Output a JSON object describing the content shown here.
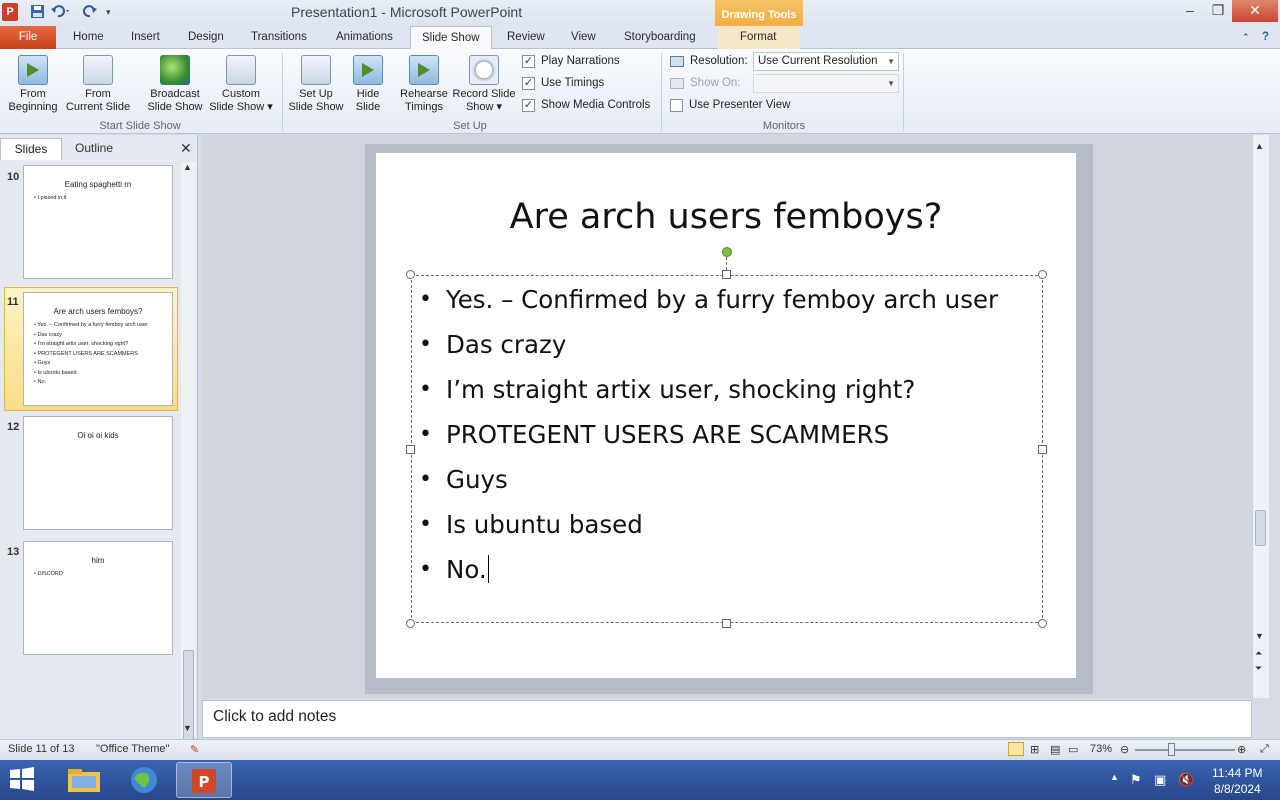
{
  "window": {
    "title": "Presentation1 - Microsoft PowerPoint",
    "contextual_tab_group": "Drawing Tools",
    "app_icon_letter": "P"
  },
  "tabs": [
    "File",
    "Home",
    "Insert",
    "Design",
    "Transitions",
    "Animations",
    "Slide Show",
    "Review",
    "View",
    "Storyboarding",
    "Format"
  ],
  "ribbon": {
    "start_group": {
      "label": "Start Slide Show",
      "from_beginning": [
        "From",
        "Beginning"
      ],
      "from_current": [
        "From",
        "Current Slide"
      ],
      "broadcast": [
        "Broadcast",
        "Slide Show"
      ],
      "custom": [
        "Custom",
        "Slide Show ▾"
      ]
    },
    "setup_group": {
      "label": "Set Up",
      "setup_show": [
        "Set Up",
        "Slide Show"
      ],
      "hide_slide": [
        "Hide",
        "Slide"
      ],
      "rehearse": [
        "Rehearse",
        "Timings"
      ],
      "record": [
        "Record Slide",
        "Show ▾"
      ],
      "play_narrations": "Play Narrations",
      "use_timings": "Use Timings",
      "show_media_controls": "Show Media Controls"
    },
    "monitors_group": {
      "label": "Monitors",
      "resolution_label": "Resolution:",
      "resolution_value": "Use Current Resolution",
      "show_on_label": "Show On:",
      "presenter_view": "Use Presenter View"
    }
  },
  "panel": {
    "tab_slides": "Slides",
    "tab_outline": "Outline",
    "thumbnails": [
      {
        "num": "10",
        "title": "Eating spaghetti rn",
        "bullets": [
          "I pissed in it"
        ]
      },
      {
        "num": "11",
        "title": "Are arch users femboys?",
        "bullets": [
          "Yes. – Confirmed by a furry femboy arch user",
          "Das crazy",
          "I’m straight artix user, shocking right?",
          "PROTEGENT USERS ARE SCAMMERS",
          "Guys",
          "Is ubuntu based",
          "No."
        ]
      },
      {
        "num": "12",
        "title": "Oi oi oi kids",
        "bullets": []
      },
      {
        "num": "13",
        "title": "him",
        "bullets": [
          "DISCORD"
        ]
      }
    ]
  },
  "slide": {
    "title": "Are arch users femboys?",
    "bullets": [
      "Yes. – Confirmed by a furry femboy arch user",
      "Das crazy",
      "I’m straight artix user, shocking right?",
      "PROTEGENT USERS ARE SCAMMERS",
      "Guys",
      "Is ubuntu based",
      "No."
    ]
  },
  "notes": {
    "placeholder": "Click to add notes"
  },
  "status": {
    "slide_indicator": "Slide 11 of 13",
    "theme": "\"Office Theme\"",
    "zoom": "73%"
  },
  "taskbar": {
    "time": "11:44 PM",
    "date": "8/8/2024"
  },
  "colors": {
    "file_tab": "#c7441d",
    "drawing_tools": "#f2a93e",
    "selected_thumb": "#f9dd85",
    "rotation_handle": "#7ac143"
  }
}
